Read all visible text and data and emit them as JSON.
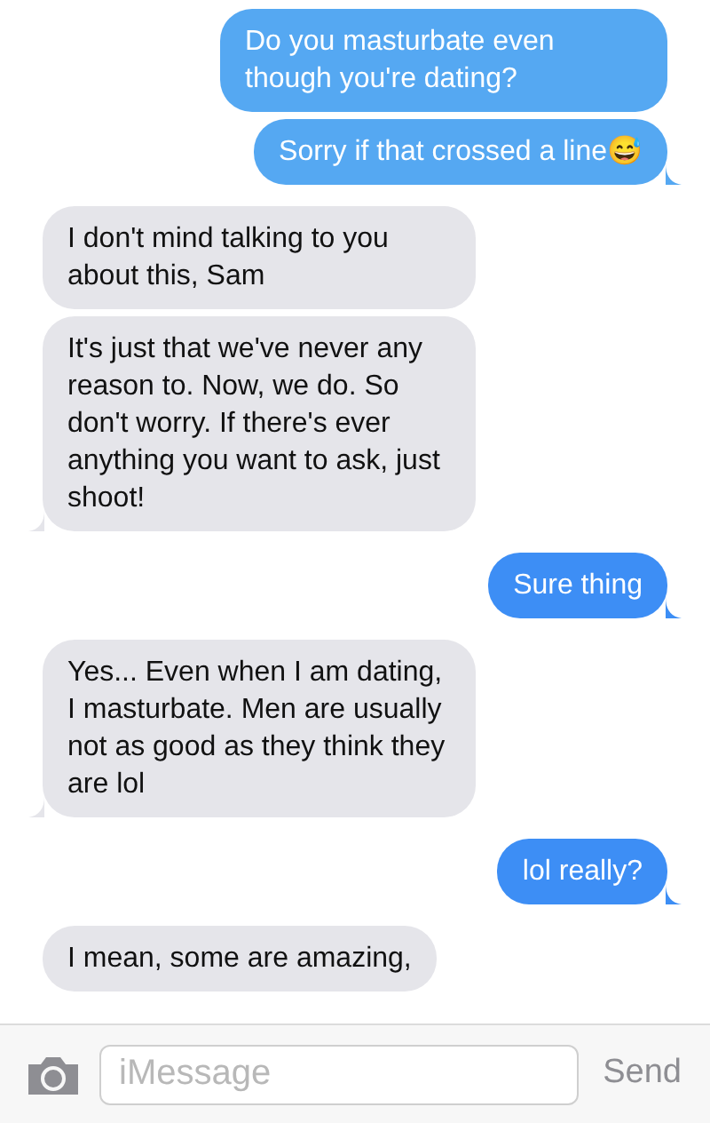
{
  "messages": [
    {
      "kind": "sent",
      "text": "Do you masturbate even though you're dating?",
      "tail": false,
      "color": "#55a8f2"
    },
    {
      "kind": "sent",
      "text": "Sorry if that crossed a line😅",
      "tail": true,
      "color": "#55a8f2"
    },
    {
      "kind": "received",
      "text": "I don't mind talking to you about this, Sam",
      "tail": false
    },
    {
      "kind": "received",
      "text": "It's just that we've never any reason to. Now, we do. So don't worry. If there's ever anything you want to ask, just shoot!",
      "tail": true
    },
    {
      "kind": "sent",
      "text": "Sure thing",
      "tail": true,
      "color": "#3d8ef5"
    },
    {
      "kind": "received",
      "text": "Yes... Even when I am dating, I masturbate. Men are usually not as good as they think they are lol",
      "tail": true
    },
    {
      "kind": "sent",
      "text": "lol really?",
      "tail": true,
      "color": "#3d8ef5"
    },
    {
      "kind": "received",
      "text": "I mean, some are amazing,"
    }
  ],
  "composer": {
    "placeholder": "iMessage",
    "send": "Send"
  }
}
